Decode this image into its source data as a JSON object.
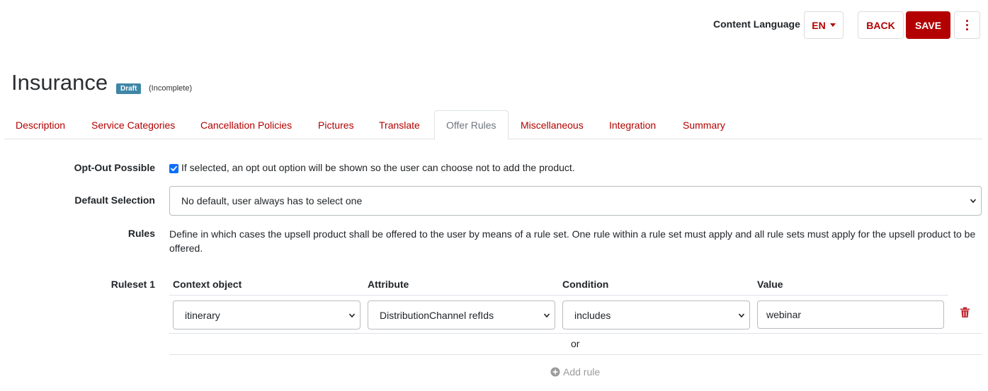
{
  "header": {
    "content_language_label": "Content Language",
    "language_value": "EN",
    "back_label": "BACK",
    "save_label": "SAVE"
  },
  "page": {
    "title": "Insurance",
    "status_badge": "Draft",
    "status_note": "(Incomplete)"
  },
  "tabs": [
    {
      "label": "Description"
    },
    {
      "label": "Service Categories"
    },
    {
      "label": "Cancellation Policies"
    },
    {
      "label": "Pictures"
    },
    {
      "label": "Translate"
    },
    {
      "label": "Offer Rules",
      "active": true
    },
    {
      "label": "Miscellaneous"
    },
    {
      "label": "Integration"
    },
    {
      "label": "Summary"
    }
  ],
  "form": {
    "opt_out": {
      "label": "Opt-Out Possible",
      "checked": true,
      "text": "If selected, an opt out option will be shown so the user can choose not to add the product."
    },
    "default_selection": {
      "label": "Default Selection",
      "value": "No default, user always has to select one"
    },
    "rules": {
      "label": "Rules",
      "description": "Define in which cases the upsell product shall be offered to the user by means of a rule set. One rule within a rule set must apply and all rule sets must apply for the upsell product to be offered."
    },
    "ruleset": {
      "label": "Ruleset 1",
      "columns": [
        "Context object",
        "Attribute",
        "Condition",
        "Value"
      ],
      "rows": [
        {
          "context_object": "itinerary",
          "attribute": "DistributionChannel refIds",
          "condition": "includes",
          "value": "webinar"
        }
      ],
      "or_label": "or",
      "add_rule_label": "Add rule"
    }
  },
  "colors": {
    "accent": "#b30000",
    "badge": "#3f86a6",
    "checkbox": "#0d6efd"
  },
  "icons": {
    "language_caret": "caret-down-icon",
    "more": "more-vertical-icon",
    "delete": "trash-icon",
    "add": "plus-circle-icon"
  }
}
